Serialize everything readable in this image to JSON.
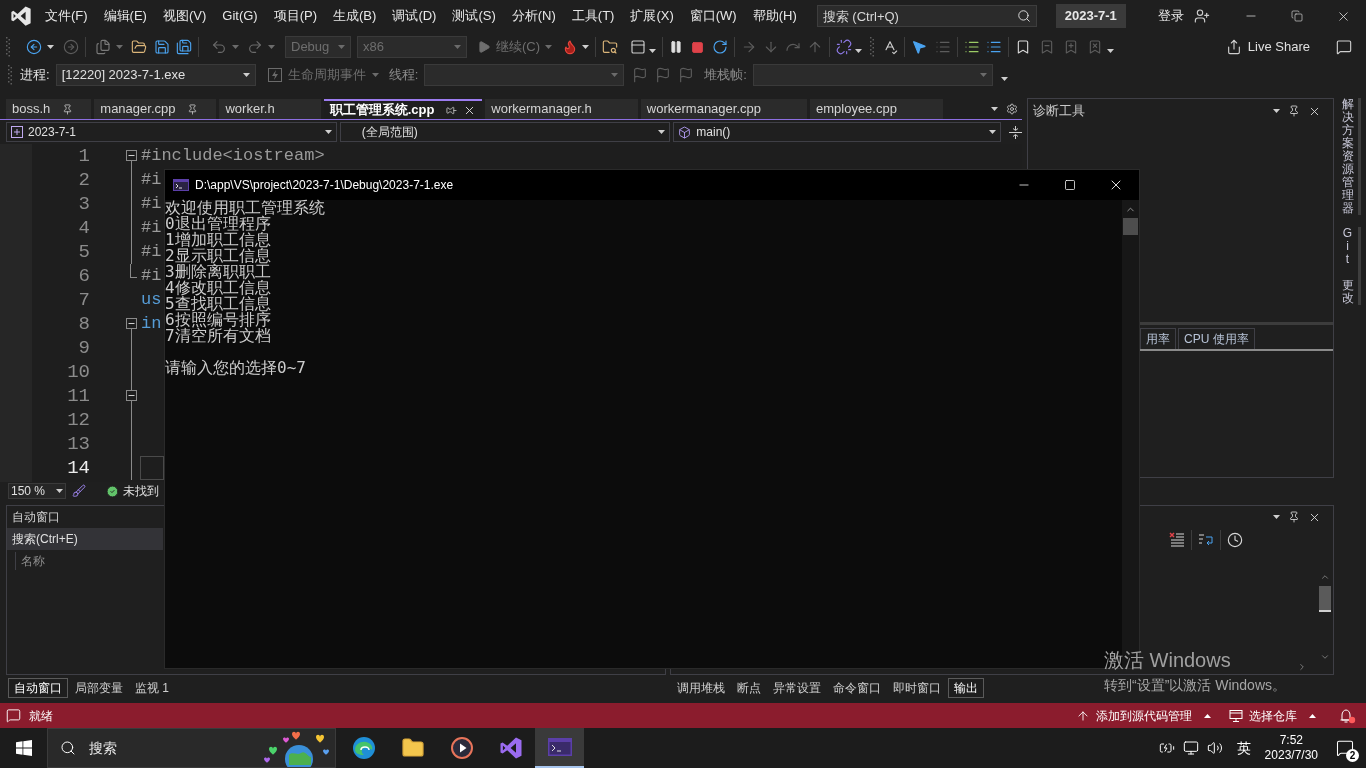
{
  "menu_bar": {
    "items": [
      "文件(F)",
      "编辑(E)",
      "视图(V)",
      "Git(G)",
      "项目(P)",
      "生成(B)",
      "调试(D)",
      "测试(S)",
      "分析(N)",
      "工具(T)",
      "扩展(X)",
      "窗口(W)",
      "帮助(H)"
    ],
    "search": {
      "placeholder": "搜索 (Ctrl+Q)"
    },
    "solution": "2023-7-1",
    "sign_in": "登录"
  },
  "toolbar": {
    "configuration": "Debug",
    "platform": "x86",
    "continue": "继续(C)",
    "live_share": "Live Share"
  },
  "debug_location": {
    "process_label": "进程:",
    "process": "[12220] 2023-7-1.exe",
    "lifecycle_events": "生命周期事件",
    "thread_label": "线程:",
    "stack_frame_label": "堆栈帧:"
  },
  "document_tabs": [
    {
      "label": "boss.h",
      "pinned": true,
      "selected": false
    },
    {
      "label": "manager.cpp",
      "pinned": true,
      "selected": false
    },
    {
      "label": "worker.h",
      "pinned": false,
      "selected": false
    },
    {
      "label": "职工管理系统.cpp",
      "pinned": false,
      "selected": true
    },
    {
      "label": "workermanager.h",
      "pinned": false,
      "selected": false
    },
    {
      "label": "workermanager.cpp",
      "pinned": false,
      "selected": false
    },
    {
      "label": "employee.cpp",
      "pinned": false,
      "selected": false
    }
  ],
  "navigation_bar": {
    "project": "2023-7-1",
    "scope": "(全局范围)",
    "member": "main()"
  },
  "editor": {
    "lines": [
      {
        "number": "1",
        "code": "#include<iostream>",
        "kind": "directive",
        "current": false,
        "children": [
          {
            "number": "2",
            "code": "#i",
            "kind": "directive",
            "current": false
          },
          {
            "number": "3",
            "code": "#i",
            "kind": "directive",
            "current": false
          },
          {
            "number": "4",
            "code": "#i",
            "kind": "directive",
            "current": false
          },
          {
            "number": "5",
            "code": "#i",
            "kind": "directive",
            "current": false
          },
          {
            "number": "6",
            "code": "#i",
            "kind": "directive",
            "current": false
          }
        ]
      },
      {
        "number": "7",
        "code": "us",
        "kind": "keyword",
        "current": false
      },
      {
        "number": "8",
        "code": "in",
        "kind": "keyword",
        "current": false,
        "children": [
          {
            "number": "9",
            "current": false
          },
          {
            "number": "10",
            "current": false
          },
          {
            "number": "11",
            "current": false,
            "children": [
              {
                "number": "12",
                "current": false
              },
              {
                "number": "13",
                "current": false
              },
              {
                "number": "14",
                "current": true
              }
            ]
          }
        ]
      }
    ],
    "zoom": "150 %",
    "issues": "未找到"
  },
  "console_window": {
    "title": "D:\\app\\VS\\project\\2023-7-1\\Debug\\2023-7-1.exe",
    "lines": [
      "欢迎使用职工管理系统",
      "0退出管理程序",
      "1增加职工信息",
      "2显示职工信息",
      "3删除离职职工",
      "4修改职工信息",
      "5查找职工信息",
      "6按照编号排序",
      "7清空所有文档"
    ],
    "prompt": "请输入您的选择0~7"
  },
  "diagnostic_tools": {
    "title": "诊断工具",
    "tabs": [
      {
        "label": "用率",
        "selected": false
      },
      {
        "label": "CPU 使用率",
        "selected": false
      }
    ]
  },
  "side_tabs": [
    "解决方案资源管理器",
    "Git 更改"
  ],
  "autos_window": {
    "title": "自动窗口",
    "search": {
      "placeholder": "搜索(Ctrl+E)"
    },
    "columns": [
      "名称"
    ],
    "tabs": [
      {
        "label": "自动窗口",
        "selected": true
      },
      {
        "label": "局部变量",
        "selected": false
      },
      {
        "label": "监视 1",
        "selected": false
      }
    ]
  },
  "output_panel": {
    "tabs": [
      {
        "label": "调用堆栈",
        "selected": false
      },
      {
        "label": "断点",
        "selected": false
      },
      {
        "label": "异常设置",
        "selected": false
      },
      {
        "label": "命令窗口",
        "selected": false
      },
      {
        "label": "即时窗口",
        "selected": false
      },
      {
        "label": "输出",
        "selected": true
      }
    ]
  },
  "status_bar": {
    "state": "就绪",
    "source_control": "添加到源代码管理",
    "repository": "选择仓库"
  },
  "taskbar": {
    "search": {
      "placeholder": "搜索"
    },
    "apps": [
      {
        "kind": "browser",
        "selected": false
      },
      {
        "kind": "explorer",
        "selected": false
      },
      {
        "kind": "player",
        "selected": false
      },
      {
        "kind": "studio",
        "selected": false
      },
      {
        "kind": "console",
        "selected": true
      }
    ],
    "input_method": "英",
    "time": "7:52",
    "date": "2023/7/30",
    "notification_count": "2"
  },
  "activation_notice": {
    "title": "激活 Windows",
    "hint": "转到“设置”以激活 Windows。"
  }
}
